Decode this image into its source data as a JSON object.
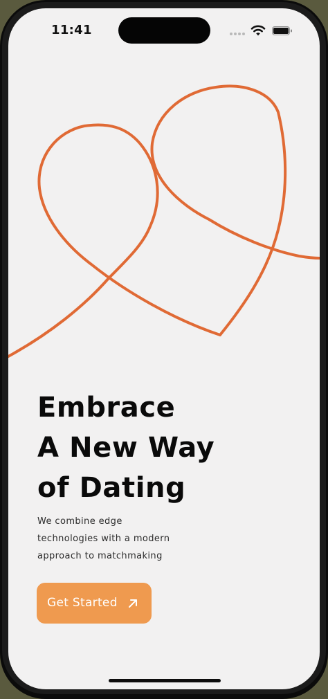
{
  "status_bar": {
    "time": "11:41",
    "icons": [
      "cellular-dots-icon",
      "wifi-icon",
      "battery-icon"
    ]
  },
  "hero": {
    "illustration": "two-hearts-line-art",
    "line_color": "#e06a35"
  },
  "headline": {
    "lines": [
      "Embrace",
      "A New Way",
      "of Dating"
    ]
  },
  "subtext": {
    "lines": [
      "We combine edge",
      "technologies with a modern",
      "approach to matchmaking"
    ]
  },
  "cta": {
    "label": "Get Started",
    "icon": "arrow-up-right-icon",
    "color": "#ef9a4f"
  },
  "theme": {
    "background": "#f2f1f1",
    "text": "#0a0a0a"
  }
}
